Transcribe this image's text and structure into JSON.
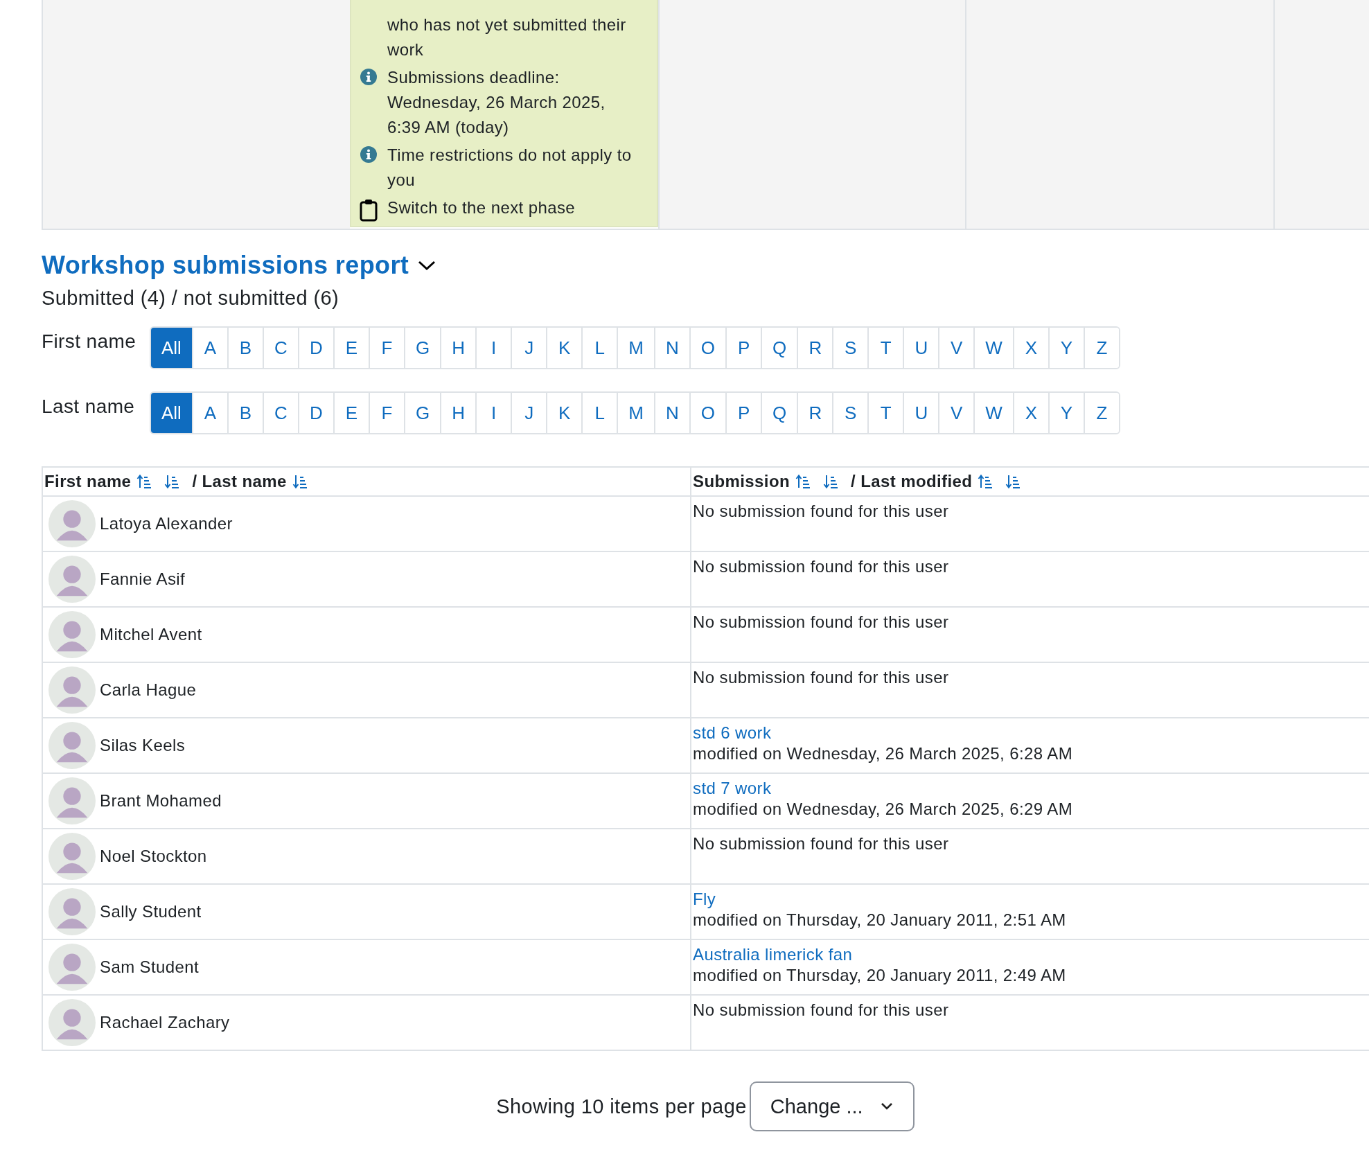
{
  "phase_columns": [
    {
      "active": false
    },
    {
      "active": true,
      "items": [
        {
          "kind": "text",
          "text": "who has not yet submitted their work"
        },
        {
          "kind": "info",
          "text": "Submissions deadline: Wednesday, 26 March 2025, 6:39 AM (today)"
        },
        {
          "kind": "info",
          "text": "Time restrictions do not apply to you"
        },
        {
          "kind": "action",
          "text": "Switch to the next phase"
        }
      ]
    },
    {
      "active": false
    },
    {
      "active": false
    },
    {
      "active": false
    }
  ],
  "report": {
    "title": "Workshop submissions report",
    "summary": "Submitted (4) / not submitted (6)"
  },
  "filters": [
    {
      "label": "First name",
      "letters": [
        {
          "text": "All",
          "selected": true
        },
        {
          "text": "A",
          "selected": false
        },
        {
          "text": "B",
          "selected": false
        },
        {
          "text": "C",
          "selected": false
        },
        {
          "text": "D",
          "selected": false
        },
        {
          "text": "E",
          "selected": false
        },
        {
          "text": "F",
          "selected": false
        },
        {
          "text": "G",
          "selected": false
        },
        {
          "text": "H",
          "selected": false
        },
        {
          "text": "I",
          "selected": false
        },
        {
          "text": "J",
          "selected": false
        },
        {
          "text": "K",
          "selected": false
        },
        {
          "text": "L",
          "selected": false
        },
        {
          "text": "M",
          "selected": false
        },
        {
          "text": "N",
          "selected": false
        },
        {
          "text": "O",
          "selected": false
        },
        {
          "text": "P",
          "selected": false
        },
        {
          "text": "Q",
          "selected": false
        },
        {
          "text": "R",
          "selected": false
        },
        {
          "text": "S",
          "selected": false
        },
        {
          "text": "T",
          "selected": false
        },
        {
          "text": "U",
          "selected": false
        },
        {
          "text": "V",
          "selected": false
        },
        {
          "text": "W",
          "selected": false
        },
        {
          "text": "X",
          "selected": false
        },
        {
          "text": "Y",
          "selected": false
        },
        {
          "text": "Z",
          "selected": false
        }
      ]
    },
    {
      "label": "Last name",
      "letters": [
        {
          "text": "All",
          "selected": true
        },
        {
          "text": "A",
          "selected": false
        },
        {
          "text": "B",
          "selected": false
        },
        {
          "text": "C",
          "selected": false
        },
        {
          "text": "D",
          "selected": false
        },
        {
          "text": "E",
          "selected": false
        },
        {
          "text": "F",
          "selected": false
        },
        {
          "text": "G",
          "selected": false
        },
        {
          "text": "H",
          "selected": false
        },
        {
          "text": "I",
          "selected": false
        },
        {
          "text": "J",
          "selected": false
        },
        {
          "text": "K",
          "selected": false
        },
        {
          "text": "L",
          "selected": false
        },
        {
          "text": "M",
          "selected": false
        },
        {
          "text": "N",
          "selected": false
        },
        {
          "text": "O",
          "selected": false
        },
        {
          "text": "P",
          "selected": false
        },
        {
          "text": "Q",
          "selected": false
        },
        {
          "text": "R",
          "selected": false
        },
        {
          "text": "S",
          "selected": false
        },
        {
          "text": "T",
          "selected": false
        },
        {
          "text": "U",
          "selected": false
        },
        {
          "text": "V",
          "selected": false
        },
        {
          "text": "W",
          "selected": false
        },
        {
          "text": "X",
          "selected": false
        },
        {
          "text": "Y",
          "selected": false
        },
        {
          "text": "Z",
          "selected": false
        }
      ]
    }
  ],
  "table": {
    "columns": [
      {
        "parts": [
          {
            "kind": "label",
            "text": "First name"
          },
          {
            "kind": "sort-asc"
          },
          {
            "kind": "sort-desc"
          },
          {
            "kind": "label",
            "text": "/ Last name"
          },
          {
            "kind": "sort-desc"
          }
        ]
      },
      {
        "parts": [
          {
            "kind": "label",
            "text": "Submission"
          },
          {
            "kind": "sort-asc"
          },
          {
            "kind": "sort-desc"
          },
          {
            "kind": "label",
            "text": "/ Last modified"
          },
          {
            "kind": "sort-asc"
          },
          {
            "kind": "sort-desc"
          }
        ]
      }
    ],
    "rows": [
      {
        "name": "Latoya Alexander",
        "submission": {
          "kind": "none",
          "text": "No submission found for this user"
        }
      },
      {
        "name": "Fannie Asif",
        "submission": {
          "kind": "none",
          "text": "No submission found for this user"
        }
      },
      {
        "name": "Mitchel Avent",
        "submission": {
          "kind": "none",
          "text": "No submission found for this user"
        }
      },
      {
        "name": "Carla Hague",
        "submission": {
          "kind": "none",
          "text": "No submission found for this user"
        }
      },
      {
        "name": "Silas Keels",
        "submission": {
          "kind": "submitted",
          "title": "std 6 work",
          "modified": "modified on Wednesday, 26 March 2025, 6:28 AM"
        }
      },
      {
        "name": "Brant Mohamed",
        "submission": {
          "kind": "submitted",
          "title": "std 7 work",
          "modified": "modified on Wednesday, 26 March 2025, 6:29 AM"
        }
      },
      {
        "name": "Noel Stockton",
        "submission": {
          "kind": "none",
          "text": "No submission found for this user"
        }
      },
      {
        "name": "Sally Student",
        "submission": {
          "kind": "submitted",
          "title": "Fly",
          "modified": "modified on Thursday, 20 January 2011, 2:51 AM"
        }
      },
      {
        "name": "Sam Student",
        "submission": {
          "kind": "submitted",
          "title": "Australia limerick fan",
          "modified": "modified on Thursday, 20 January 2011, 2:49 AM"
        }
      },
      {
        "name": "Rachael Zachary",
        "submission": {
          "kind": "none",
          "text": "No submission found for this user"
        }
      }
    ]
  },
  "pager": {
    "text": "Showing 10 items per page",
    "select": "Change ..."
  }
}
